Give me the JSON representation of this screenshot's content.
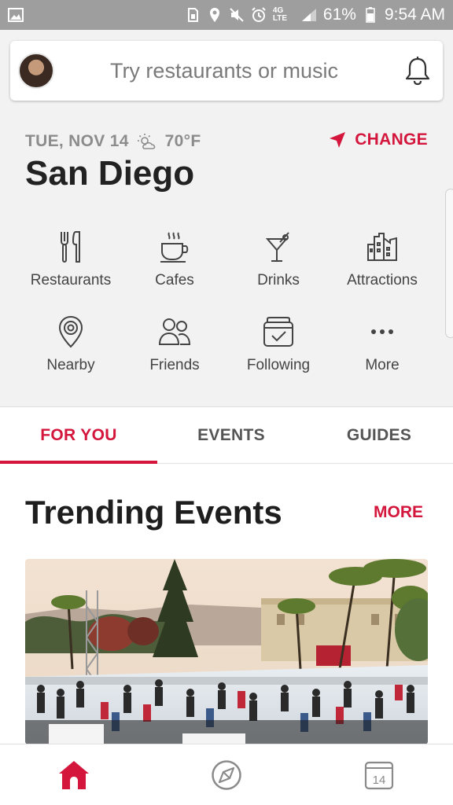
{
  "status_bar": {
    "network": "4G LTE",
    "battery": "61%",
    "time": "9:54 AM"
  },
  "search": {
    "placeholder": "Try restaurants or music"
  },
  "location": {
    "date": "TUE, NOV 14",
    "weather": "70°F",
    "city": "San Diego",
    "change_label": "CHANGE"
  },
  "categories": [
    {
      "label": "Restaurants",
      "icon": "fork-knife-icon"
    },
    {
      "label": "Cafes",
      "icon": "coffee-cup-icon"
    },
    {
      "label": "Drinks",
      "icon": "cocktail-icon"
    },
    {
      "label": "Attractions",
      "icon": "buildings-icon"
    },
    {
      "label": "Nearby",
      "icon": "location-pin-icon"
    },
    {
      "label": "Friends",
      "icon": "people-icon"
    },
    {
      "label": "Following",
      "icon": "calendar-check-icon"
    },
    {
      "label": "More",
      "icon": "dots-icon"
    }
  ],
  "tabs": [
    {
      "label": "FOR YOU",
      "active": true
    },
    {
      "label": "EVENTS",
      "active": false
    },
    {
      "label": "GUIDES",
      "active": false
    }
  ],
  "trending": {
    "title": "Trending Events",
    "more_label": "MORE"
  },
  "bottom_nav": {
    "calendar_day": "14"
  },
  "colors": {
    "accent": "#d4163c",
    "status_bar": "#9e9e9e",
    "panel_bg": "#f2f2f3"
  }
}
